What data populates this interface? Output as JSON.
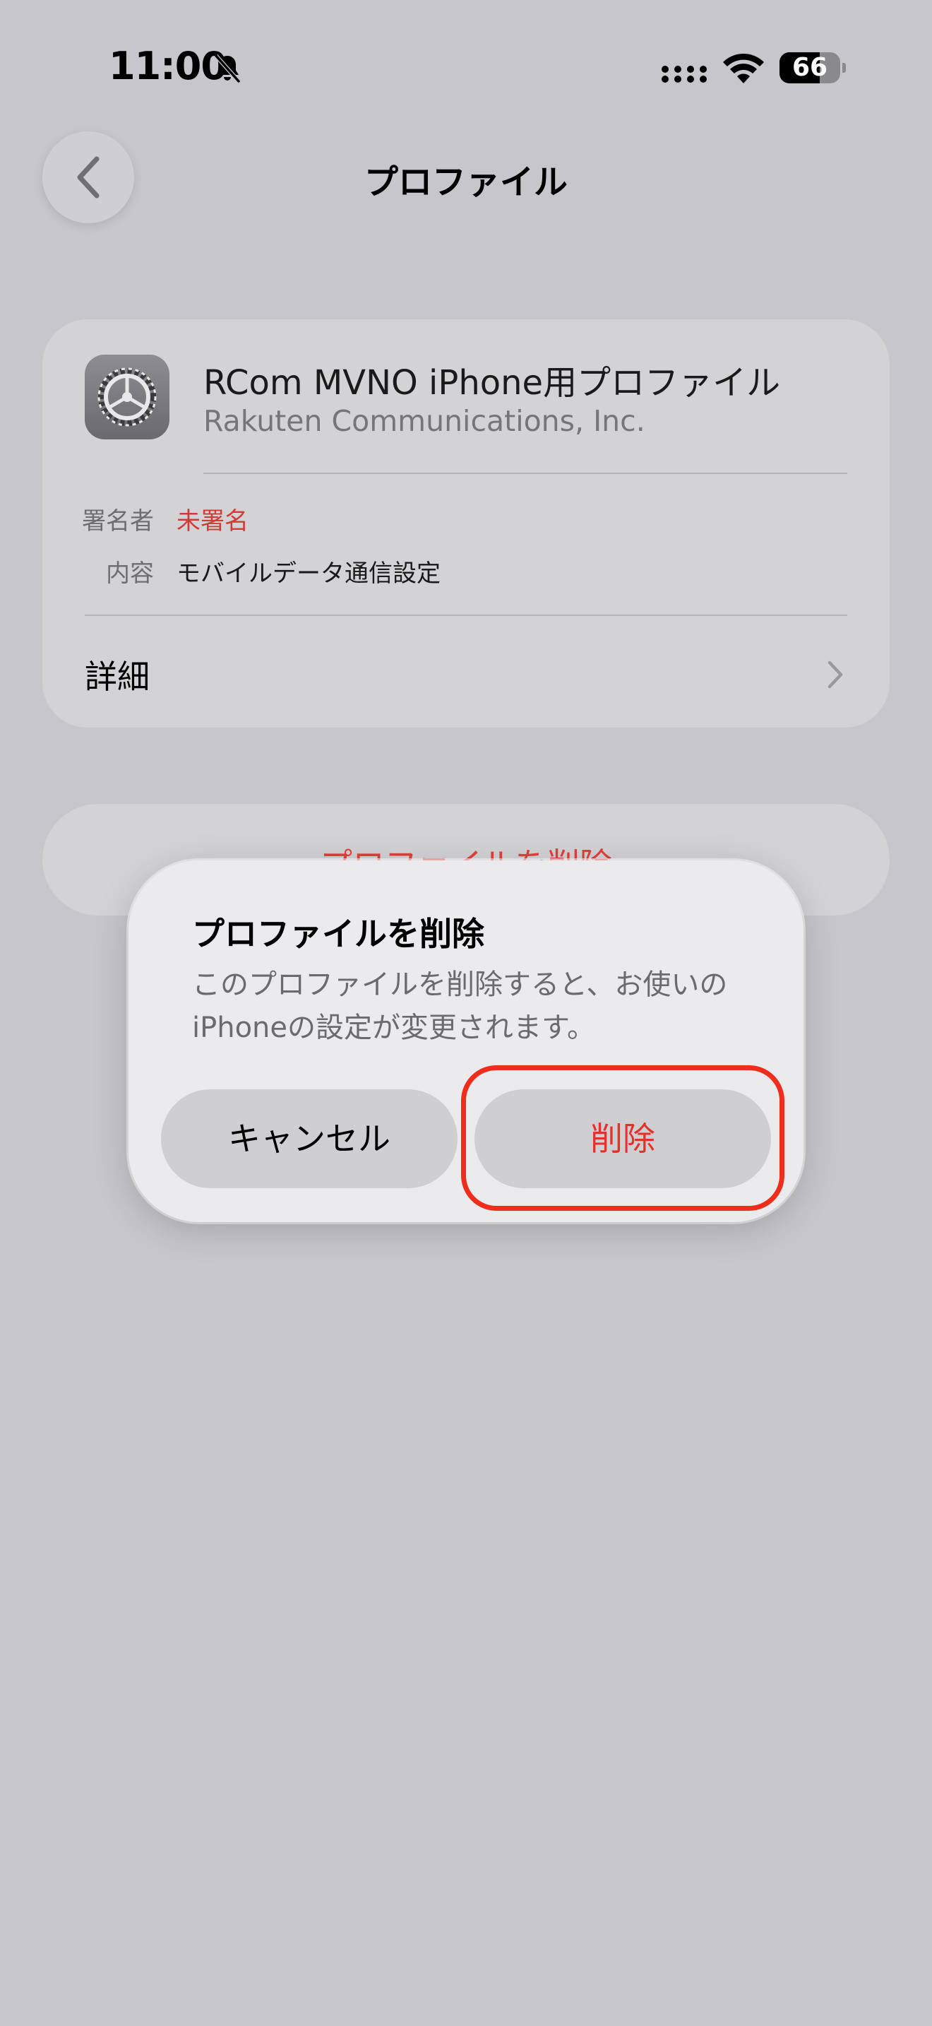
{
  "status_bar": {
    "time": "11:00",
    "battery_level": "66",
    "battery_fraction": 0.66,
    "icons": [
      "bell-slash-icon",
      "cellular-icon",
      "wifi-icon",
      "battery-icon"
    ]
  },
  "nav": {
    "title": "プロファイル",
    "back_icon": "chevron-left-icon"
  },
  "profile": {
    "name": "RCom MVNO iPhone用プロファイル",
    "organization": "Rakuten Communications, Inc.",
    "icon": "settings-gear-icon",
    "signer_label": "署名者",
    "signer_value": "未署名",
    "content_label": "内容",
    "content_value": "モバイルデータ通信設定",
    "details_label": "詳細"
  },
  "remove_button": {
    "label": "プロファイルを削除"
  },
  "dialog": {
    "title": "プロファイルを削除",
    "message": "このプロファイルを削除すると、お使いのiPhoneの設定が変更されます。",
    "cancel_label": "キャンセル",
    "delete_label": "削除"
  },
  "colors": {
    "background": "#c6c6cb",
    "destructive": "#e5312b",
    "highlight": "#ee2d1c",
    "unsigned": "#d23a36"
  }
}
